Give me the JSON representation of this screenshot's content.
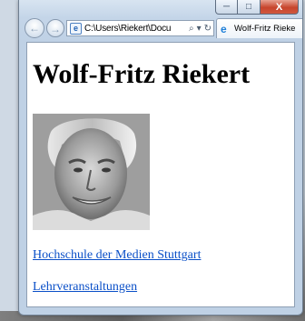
{
  "window": {
    "caption": {
      "minimize_icon": "minimize-icon",
      "maximize_icon": "maximize-icon",
      "close_label": "X"
    }
  },
  "browser": {
    "back_icon": "back-arrow-icon",
    "forward_icon": "forward-arrow-icon",
    "address_url": "C:\\Users\\Riekert\\Docu",
    "search_glyph": "⌕",
    "dropdown_glyph": "▾",
    "refresh_glyph": "↻",
    "tab_title": "Wolf-Fritz Rieke"
  },
  "page": {
    "heading": "Wolf-Fritz Riekert",
    "links": [
      {
        "text": "Hochschule der Medien Stuttgart"
      },
      {
        "text": "Lehrveranstaltungen"
      }
    ]
  },
  "colors": {
    "link": "#0b50c8",
    "close_button": "#c7452d",
    "chrome": "#c4d5e8"
  }
}
